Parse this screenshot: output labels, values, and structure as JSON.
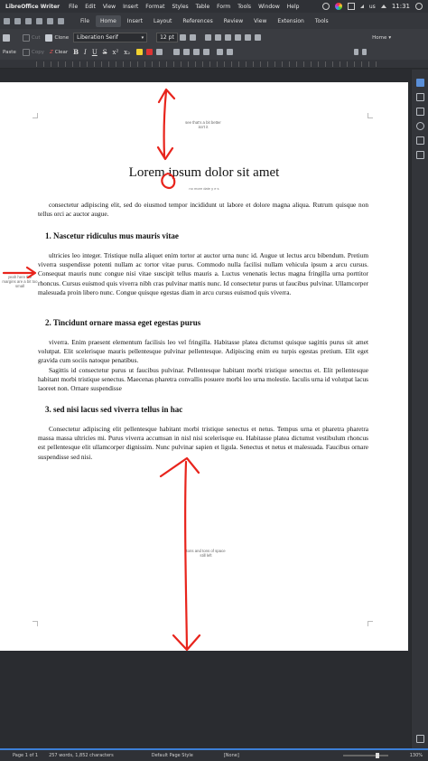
{
  "menubar": {
    "app_name": "LibreOffice Writer",
    "menus": [
      "File",
      "Edit",
      "View",
      "Insert",
      "Format",
      "Styles",
      "Table",
      "Form",
      "Tools",
      "Window",
      "Help"
    ],
    "keyboard_layout": "us",
    "clock": "11:31"
  },
  "tabs": [
    {
      "label": "File",
      "active": false
    },
    {
      "label": "Home",
      "active": true
    },
    {
      "label": "Insert",
      "active": false
    },
    {
      "label": "Layout",
      "active": false
    },
    {
      "label": "References",
      "active": false
    },
    {
      "label": "Review",
      "active": false
    },
    {
      "label": "View",
      "active": false
    },
    {
      "label": "Extension",
      "active": false
    },
    {
      "label": "Tools",
      "active": false
    }
  ],
  "toolbar": {
    "cut_label": "Cut",
    "clone_label": "Clone",
    "paste_label": "Paste",
    "copy_label": "Copy",
    "clear_label": "Clear",
    "font_name": "Liberation Serif",
    "font_size": "12 pt",
    "paragraph_style": "Home",
    "format_buttons": [
      "B",
      "I",
      "U",
      "S",
      "x²",
      "x₂"
    ]
  },
  "document": {
    "title": "Lorem ipsum dolor sit amet",
    "subtitle": "no more date y e s",
    "intro": "consectetur adipiscing elit, sed do eiusmod tempor incididunt ut labore et dolore magna aliqua. Rutrum quisque non tellus orci ac auctor augue.",
    "sections": [
      {
        "heading": "1. Nascetur ridiculus mus mauris vitae",
        "paragraphs": [
          "ultricies leo integer. Tristique nulla aliquet enim tortor at auctor urna nunc id. Augue ut lectus arcu bibendum. Pretium viverra suspendisse potenti nullam ac tortor vitae purus. Commodo nulla facilisi nullam vehicula ipsum a arcu cursus. Consequat mauris nunc congue nisi vitae suscipit tellus mauris a. Luctus venenatis lectus magna fringilla urna porttitor rhoncus. Cursus euismod quis viverra nibh cras pulvinar mattis nunc. Id consectetur purus ut faucibus pulvinar. Ullamcorper malesuada proin libero nunc. Congue quisque egestas diam in arcu cursus euismod quis viverra."
        ]
      },
      {
        "heading": "2. Tincidunt ornare massa eget egestas purus",
        "paragraphs": [
          "viverra. Enim praesent elementum facilisis leo vel fringilla. Habitasse platea dictumst quisque sagittis purus sit amet volutpat. Elit scelerisque mauris pellentesque pulvinar pellentesque. Adipiscing enim eu turpis egestas pretium. Elit eget gravida cum sociis natoque penatibus.",
          "Sagittis id consectetur purus ut faucibus pulvinar. Pellentesque habitant morbi tristique senectus et. Elit pellentesque habitant morbi tristique senectus. Maecenas pharetra convallis posuere morbi leo urna molestie. Iaculis urna id volutpat lacus laoreet non. Ornare suspendisse"
        ]
      },
      {
        "heading": "3. sed nisi lacus sed viverra tellus in hac",
        "paragraphs": [
          "Consectetur adipiscing elit pellentesque habitant morbi tristique senectus et netus. Tempus urna et pharetra pharetra massa massa ultricies mi. Purus viverra accumsan in nisl nisi scelerisque eu. Habitasse platea dictumst vestibulum rhoncus est pellentesque elit ullamcorper dignissim. Nunc pulvinar sapien et ligula. Senectus et netus et malesuada. Faucibus ornare suspendisse sed nisi."
        ]
      }
    ],
    "annotations": {
      "top_note": "see that's a bit better isn't it",
      "margin_note": "yeah here the margins are a bit too small",
      "bottom_note": "tons and tons of space still left"
    },
    "annotation_color": "#e8241c"
  },
  "statusbar": {
    "page": "Page 1 of 1",
    "words": "257 words, 1,852 characters",
    "page_style": "Default Page Style",
    "language": "[None]",
    "zoom": "130%"
  },
  "colors": {
    "accent": "#3d7fd6",
    "chrome_dark": "#2f3136",
    "page": "#ffffff"
  }
}
